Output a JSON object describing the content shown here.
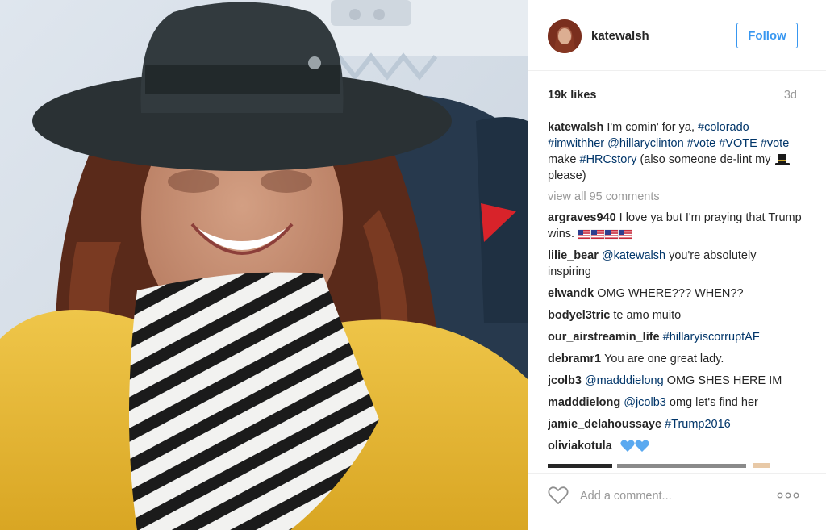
{
  "post": {
    "username": "katewalsh",
    "follow_label": "Follow",
    "likes": "19k likes",
    "age": "3d",
    "caption": {
      "username": "katewalsh",
      "text_1": "I'm comin' for ya, ",
      "tag_1": "#colorado",
      "tag_2": "#imwithher",
      "mention_1": "@hillaryclinton",
      "tag_3": "#vote",
      "tag_4": "#VOTE",
      "tag_5": "#vote",
      "text_2": "make",
      "tag_6": "#HRCstory",
      "text_3": "(also someone de-lint my",
      "text_4": "please)"
    },
    "view_all": "view all 95 comments",
    "comments": [
      {
        "user": "argraves940",
        "text": "I love ya but I'm praying that Trump wins."
      },
      {
        "user": "lilie_bear",
        "mention": "@katewalsh",
        "text": "you're absolutely inspiring"
      },
      {
        "user": "elwandk",
        "text": "OMG WHERE??? WHEN??"
      },
      {
        "user": "bodyel3tric",
        "text": "te amo muito"
      },
      {
        "user": "our_airstreamin_life",
        "tag": "#hillaryiscorruptAF"
      },
      {
        "user": "debramr1",
        "text": "You are one great lady."
      },
      {
        "user": "jcolb3",
        "mention": "@madddielong",
        "text": "OMG SHES HERE IM"
      },
      {
        "user": "madddielong",
        "mention": "@jcolb3",
        "text": "omg let's find her"
      },
      {
        "user": "jamie_delahoussaye",
        "tag": "#Trump2016"
      },
      {
        "user": "oliviakotula"
      }
    ],
    "add_comment_placeholder": "Add a comment...",
    "icons": {
      "heart": "heart-outline-icon",
      "more": "more-options-icon",
      "hat_emoji": "top-hat-emoji",
      "flag_emoji": "us-flag-emoji",
      "blue_heart_emoji": "blue-heart-emoji"
    }
  },
  "colors": {
    "link": "#003569",
    "follow": "#3897f0",
    "muted": "#999999",
    "text": "#262626",
    "sweater": "#e8b93a"
  }
}
